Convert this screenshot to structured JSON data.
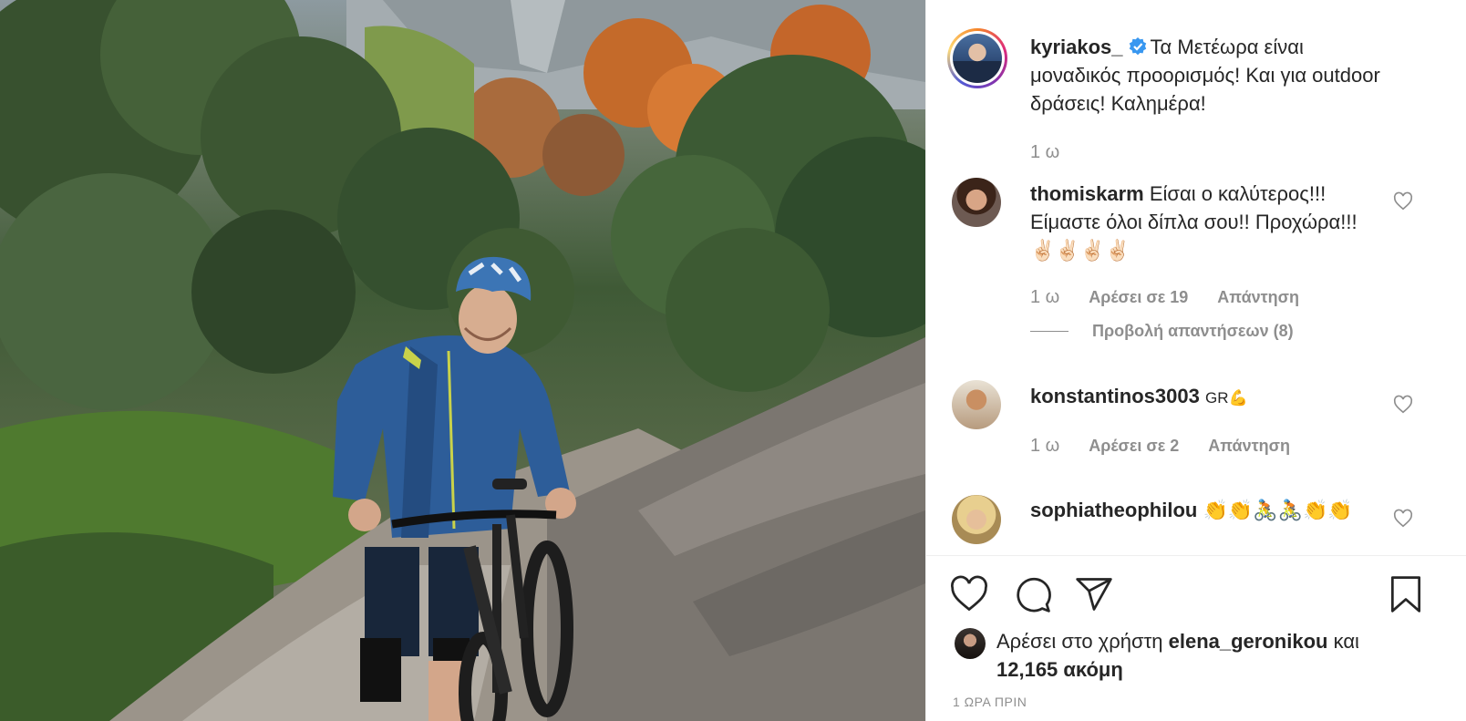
{
  "post": {
    "author": "kyriakos_",
    "caption": "Τα Μετέωρα είναι μοναδικός προορισμός! Και για outdoor δράσεις! Καλημέρα!",
    "time": "1 ω"
  },
  "comments": [
    {
      "user": "thomiskarm",
      "text": "Είσαι ο καλύτερος!!! Είμαστε όλοι δίπλα σου!! Προχώρα!!!✌🏻✌🏻✌🏻✌🏻",
      "time": "1 ω",
      "likes": "Αρέσει σε 19",
      "reply": "Απάντηση",
      "view_replies": "Προβολή απαντήσεων (8)"
    },
    {
      "user": "konstantinos3003",
      "text": "GR💪",
      "time": "1 ω",
      "likes": "Αρέσει σε 2",
      "reply": "Απάντηση"
    },
    {
      "user": "sophiatheophilou",
      "text": "👏👏🚴🚴👏👏"
    }
  ],
  "likes_bar": {
    "prefix": "Αρέσει στο χρήστη",
    "user": "elena_geronikou",
    "connector": "και",
    "count": "12,165 ακόμη"
  },
  "footer": {
    "posted": "1 ΩΡΑ ΠΡΙΝ"
  },
  "icons": {
    "like": "heart-icon",
    "comment": "comment-icon",
    "share": "share-icon",
    "save": "bookmark-icon",
    "verified": "verified-badge-icon"
  },
  "colors": {
    "verified_blue": "#3897f0",
    "muted_text": "#8e8e8e",
    "text": "#262626"
  }
}
